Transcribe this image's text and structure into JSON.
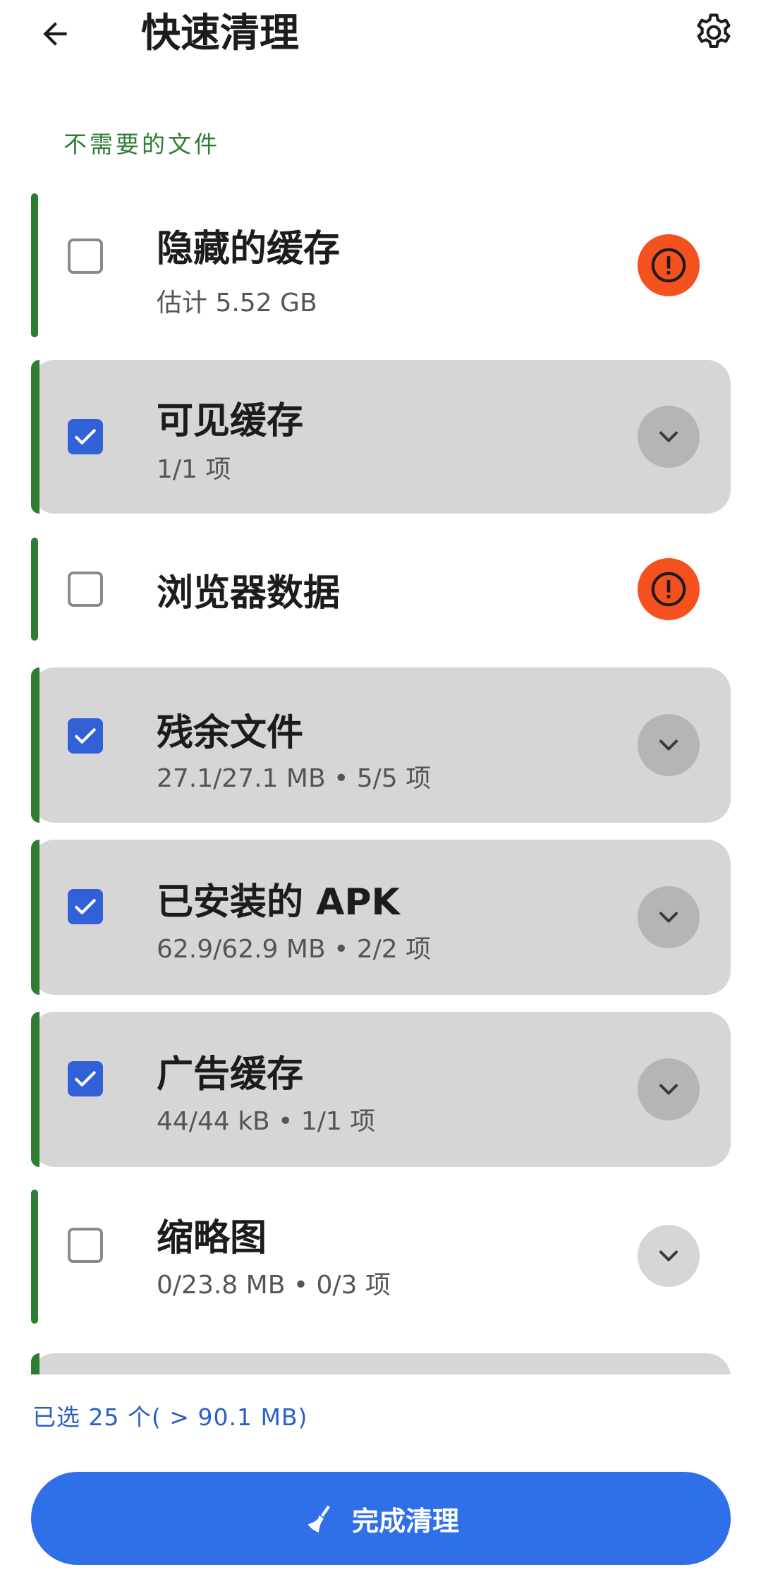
{
  "header": {
    "title": "快速清理",
    "back_icon": "arrow-left-icon",
    "settings_icon": "gear-icon"
  },
  "section": {
    "label": "不需要的文件"
  },
  "items": [
    {
      "title": "隐藏的缓存",
      "subtitle": "估计 5.52 GB",
      "checked": false,
      "action": "warning"
    },
    {
      "title": "可见缓存",
      "subtitle": "1/1 项",
      "checked": true,
      "action": "expand"
    },
    {
      "title": "浏览器数据",
      "subtitle": "",
      "checked": false,
      "action": "warning"
    },
    {
      "title": "残余文件",
      "subtitle": "27.1/27.1 MB • 5/5 项",
      "checked": true,
      "action": "expand"
    },
    {
      "title": "已安装的 APK",
      "subtitle": "62.9/62.9 MB • 2/2 项",
      "checked": true,
      "action": "expand"
    },
    {
      "title": "广告缓存",
      "subtitle": "44/44 kB • 1/1 项",
      "checked": true,
      "action": "expand"
    },
    {
      "title": "缩略图",
      "subtitle": "0/23.8 MB • 0/3 项",
      "checked": false,
      "action": "expand"
    }
  ],
  "footer": {
    "selected_summary": "已选 25 个( > 90.1 MB)",
    "finish_label": "完成清理",
    "finish_icon": "broom-icon"
  },
  "colors": {
    "accent_green": "#2e7d32",
    "warning_orange": "#f4511e",
    "primary_blue": "#2f6fe8",
    "checkbox_blue": "#3260d6",
    "selected_gray": "#d6d6d6"
  }
}
